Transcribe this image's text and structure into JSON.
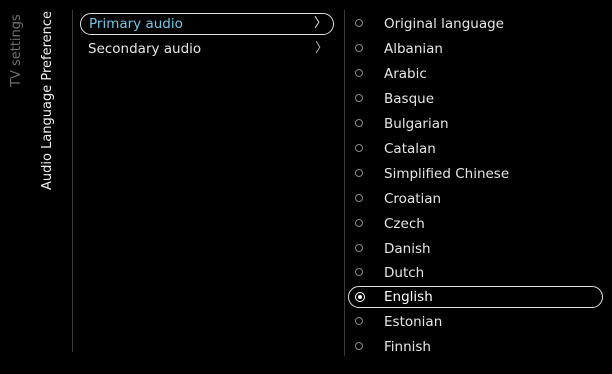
{
  "breadcrumb": {
    "root": "TV settings",
    "current": "Audio Language Preference"
  },
  "menu": {
    "items": [
      {
        "label": "Primary audio",
        "icon": "chevron-right-icon",
        "selected": true
      },
      {
        "label": "Secondary audio",
        "icon": "chevron-right-icon",
        "selected": false
      }
    ]
  },
  "languages": {
    "items": [
      {
        "label": "Original language",
        "checked": false
      },
      {
        "label": "Albanian",
        "checked": false
      },
      {
        "label": "Arabic",
        "checked": false
      },
      {
        "label": "Basque",
        "checked": false
      },
      {
        "label": "Bulgarian",
        "checked": false
      },
      {
        "label": "Catalan",
        "checked": false
      },
      {
        "label": "Simplified Chinese",
        "checked": false
      },
      {
        "label": "Croatian",
        "checked": false
      },
      {
        "label": "Czech",
        "checked": false
      },
      {
        "label": "Danish",
        "checked": false
      },
      {
        "label": "Dutch",
        "checked": false
      },
      {
        "label": "English",
        "checked": true
      },
      {
        "label": "Estonian",
        "checked": false
      },
      {
        "label": "Finnish",
        "checked": false
      }
    ]
  },
  "colors": {
    "background": "#000000",
    "highlight_text": "#6ec9e6",
    "focus_outline": "#e0e0e0"
  }
}
